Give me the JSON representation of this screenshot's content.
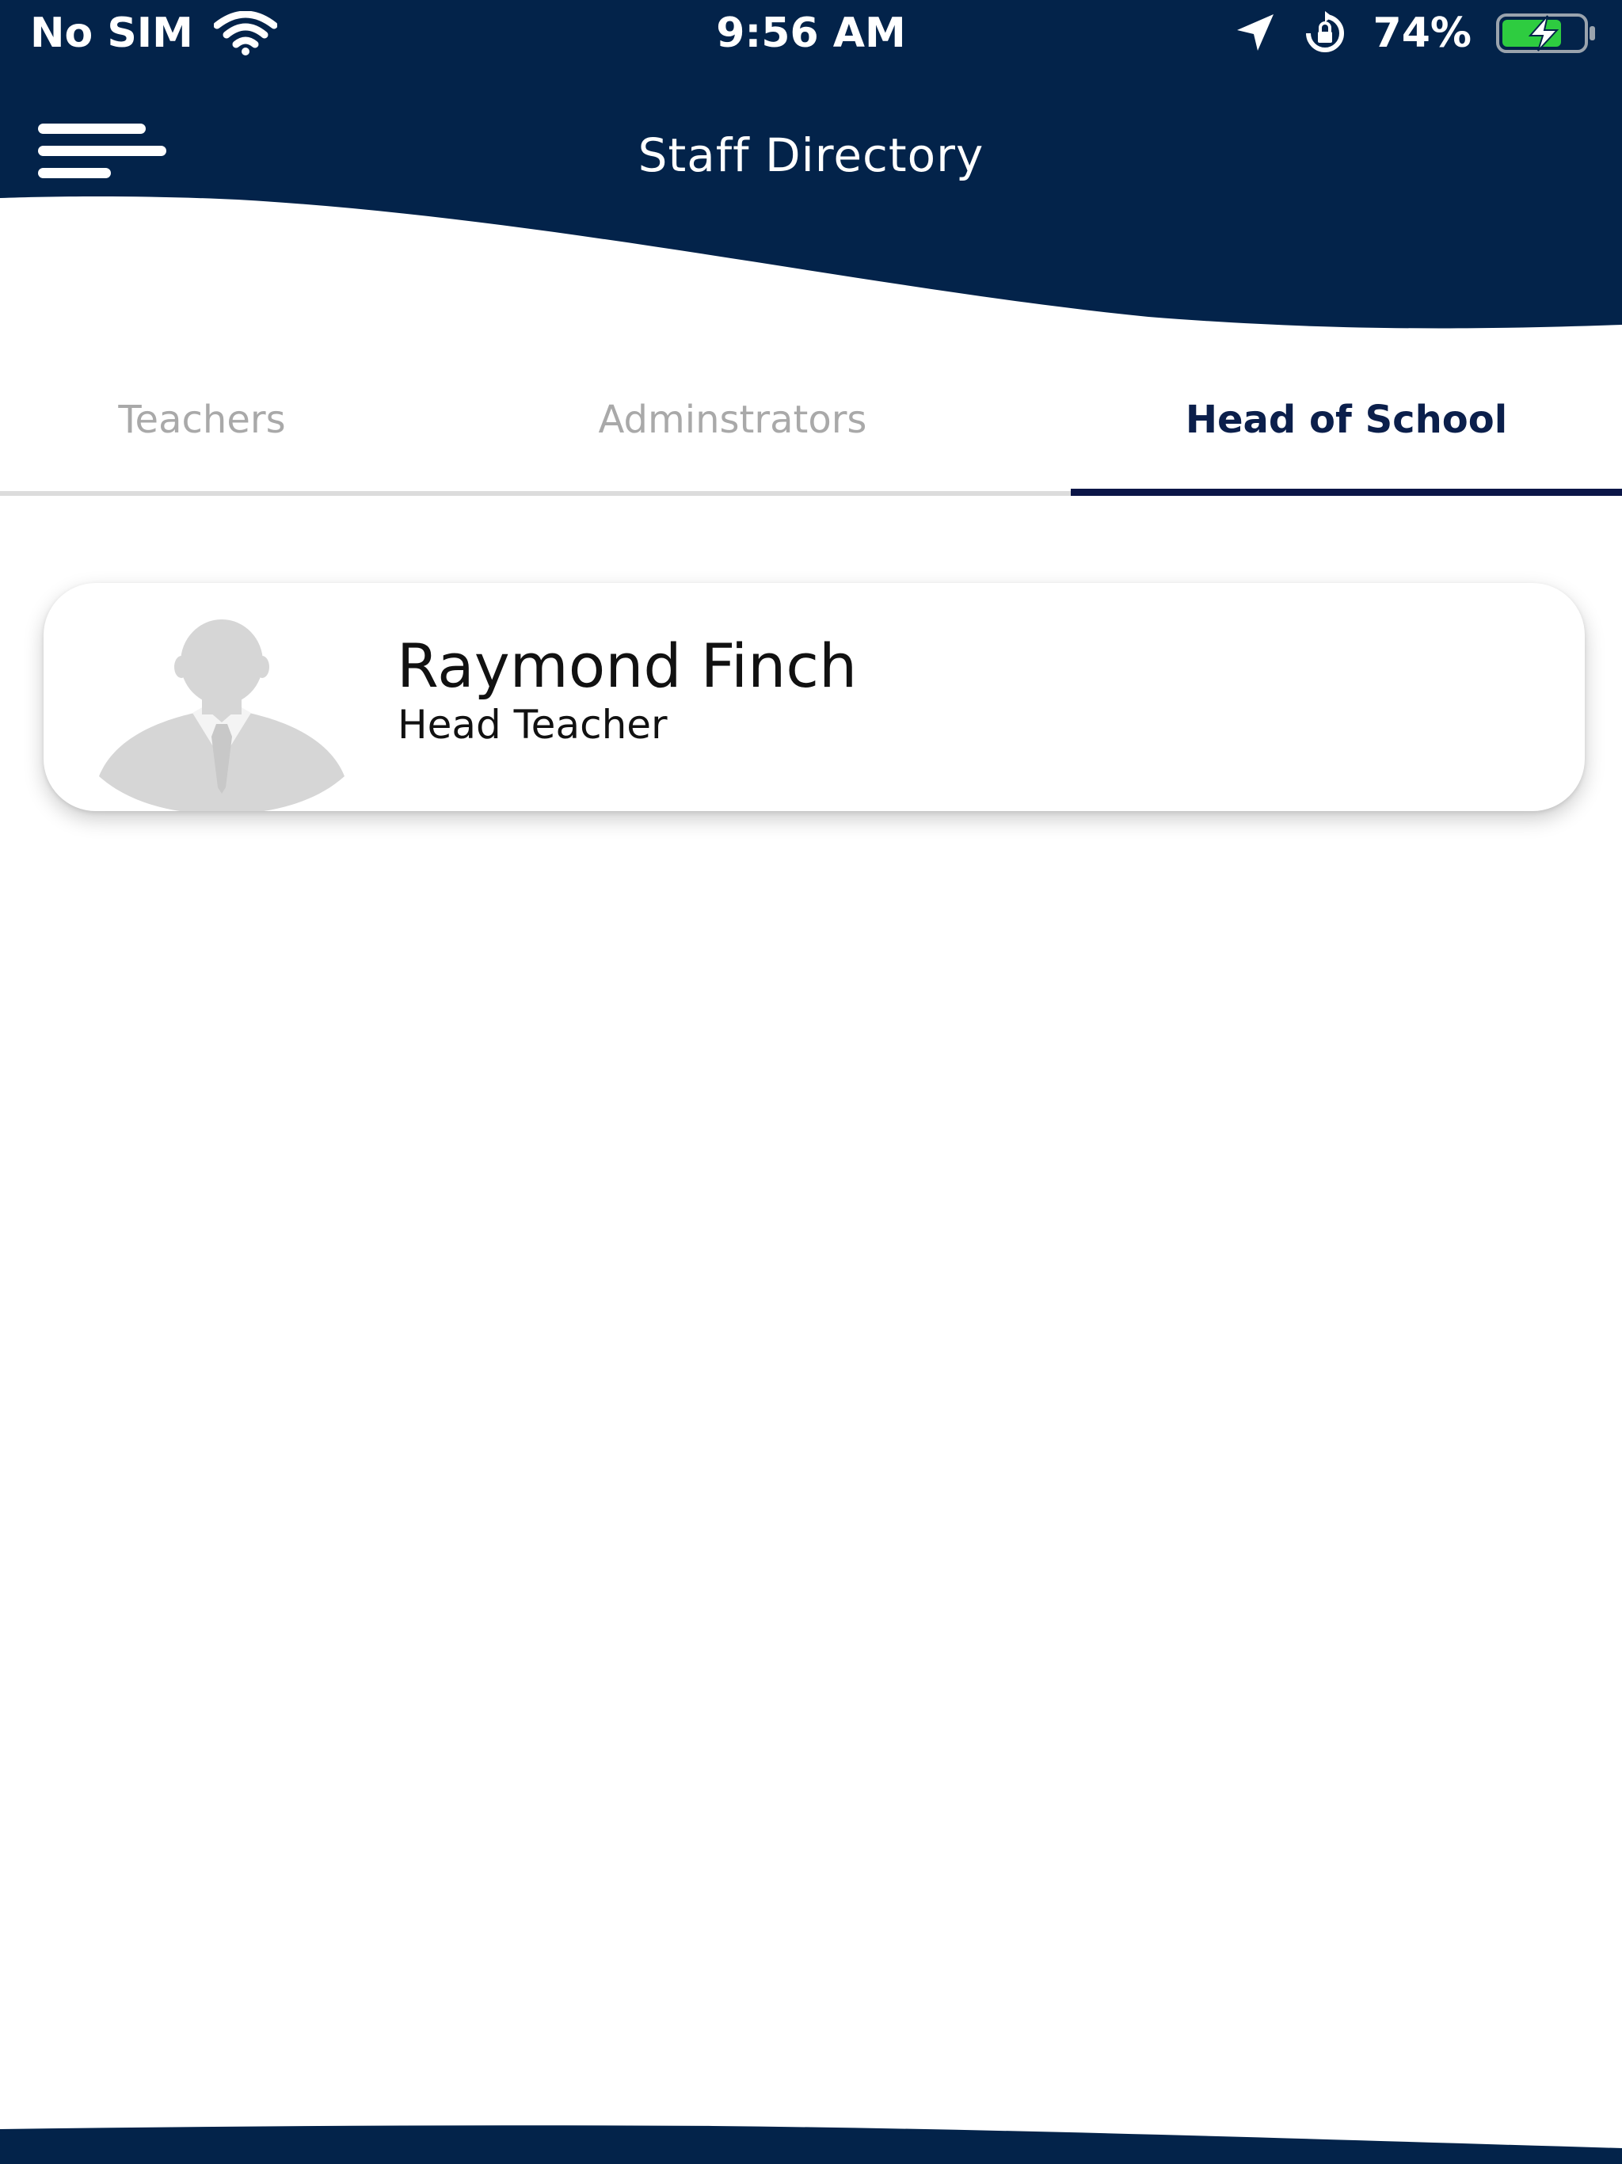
{
  "status_bar": {
    "carrier": "No SIM",
    "time": "9:56 AM",
    "battery_percent": "74%",
    "battery_level": 0.74,
    "icons": [
      "wifi-icon",
      "location-arrow-icon",
      "orientation-lock-icon",
      "battery-charging-icon"
    ]
  },
  "header": {
    "title": "Staff Directory",
    "menu_icon": "hamburger-menu-icon"
  },
  "tabs": [
    {
      "label": "Teachers",
      "selected": false
    },
    {
      "label": "Adminstrators",
      "selected": false
    },
    {
      "label": "Head of School",
      "selected": true
    }
  ],
  "staff": [
    {
      "name": "Raymond Finch",
      "role": "Head Teacher",
      "avatar_icon": "person-placeholder-icon"
    }
  ],
  "colors": {
    "primary": "#03234a",
    "tab_active_text": "#0b1f4b",
    "tab_indicator": "#0b1547",
    "tab_inactive_text": "#a9a9a9",
    "battery_fill": "#2ecc40"
  }
}
